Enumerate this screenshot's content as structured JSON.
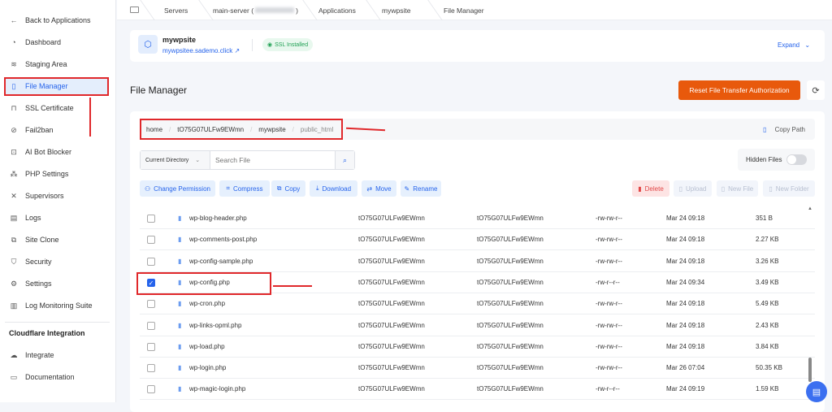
{
  "sidebar": {
    "items": [
      {
        "label": "Back to Applications",
        "icon": "arrow-left-icon"
      },
      {
        "label": "Dashboard",
        "icon": "gauge-icon"
      },
      {
        "label": "Staging Area",
        "icon": "layers-icon"
      },
      {
        "label": "File Manager",
        "icon": "file-icon",
        "active": true
      },
      {
        "label": "SSL Certificate",
        "icon": "lock-icon"
      },
      {
        "label": "Fail2ban",
        "icon": "ban-icon"
      },
      {
        "label": "AI Bot Blocker",
        "icon": "robot-icon"
      },
      {
        "label": "PHP Settings",
        "icon": "nodes-icon"
      },
      {
        "label": "Supervisors",
        "icon": "tools-icon"
      },
      {
        "label": "Logs",
        "icon": "document-icon"
      },
      {
        "label": "Site Clone",
        "icon": "copy-icon"
      },
      {
        "label": "Security",
        "icon": "shield-icon"
      },
      {
        "label": "Settings",
        "icon": "gear-icon"
      },
      {
        "label": "Log Monitoring Suite",
        "icon": "bar-chart-icon"
      }
    ],
    "section_title": "Cloudflare Integration",
    "section_items": [
      {
        "label": "Integrate",
        "icon": "cloud-icon"
      },
      {
        "label": "Documentation",
        "icon": "book-icon"
      }
    ]
  },
  "breadcrumb": [
    "Servers",
    "main-server (",
    ")",
    "Applications",
    "mywpsite",
    "File Manager"
  ],
  "app": {
    "name": "mywpsite",
    "url": "mywpsitee.sademo.click",
    "ssl": "SSL Installed",
    "expand": "Expand"
  },
  "page": {
    "title": "File Manager",
    "reset_button": "Reset File Transfer Authorization"
  },
  "path": {
    "segments": [
      "home",
      "tO75G07ULFw9EWmn",
      "mywpsite",
      "public_html"
    ],
    "copy_path": "Copy Path"
  },
  "search": {
    "scope": "Current Directory",
    "placeholder": "Search File"
  },
  "hidden_files": {
    "label": "Hidden Files",
    "enabled": false
  },
  "actions": [
    "Change Permission",
    "Compress",
    "Copy",
    "Download",
    "Move",
    "Rename"
  ],
  "actions_right": [
    "Delete",
    "Upload",
    "New File",
    "New Folder"
  ],
  "files": [
    {
      "name": "wp-blog-header.php",
      "owner": "tO75G07ULFw9EWmn",
      "group": "tO75G07ULFw9EWmn",
      "perms": "-rw-rw-r--",
      "modified": "Mar 24 09:18",
      "size": "351 B",
      "checked": false
    },
    {
      "name": "wp-comments-post.php",
      "owner": "tO75G07ULFw9EWmn",
      "group": "tO75G07ULFw9EWmn",
      "perms": "-rw-rw-r--",
      "modified": "Mar 24 09:18",
      "size": "2.27 KB",
      "checked": false
    },
    {
      "name": "wp-config-sample.php",
      "owner": "tO75G07ULFw9EWmn",
      "group": "tO75G07ULFw9EWmn",
      "perms": "-rw-rw-r--",
      "modified": "Mar 24 09:18",
      "size": "3.26 KB",
      "checked": false
    },
    {
      "name": "wp-config.php",
      "owner": "tO75G07ULFw9EWmn",
      "group": "tO75G07ULFw9EWmn",
      "perms": "-rw-r--r--",
      "modified": "Mar 24 09:34",
      "size": "3.49 KB",
      "checked": true
    },
    {
      "name": "wp-cron.php",
      "owner": "tO75G07ULFw9EWmn",
      "group": "tO75G07ULFw9EWmn",
      "perms": "-rw-rw-r--",
      "modified": "Mar 24 09:18",
      "size": "5.49 KB",
      "checked": false
    },
    {
      "name": "wp-links-opml.php",
      "owner": "tO75G07ULFw9EWmn",
      "group": "tO75G07ULFw9EWmn",
      "perms": "-rw-rw-r--",
      "modified": "Mar 24 09:18",
      "size": "2.43 KB",
      "checked": false
    },
    {
      "name": "wp-load.php",
      "owner": "tO75G07ULFw9EWmn",
      "group": "tO75G07ULFw9EWmn",
      "perms": "-rw-rw-r--",
      "modified": "Mar 24 09:18",
      "size": "3.84 KB",
      "checked": false
    },
    {
      "name": "wp-login.php",
      "owner": "tO75G07ULFw9EWmn",
      "group": "tO75G07ULFw9EWmn",
      "perms": "-rw-rw-r--",
      "modified": "Mar 26 07:04",
      "size": "50.35 KB",
      "checked": false
    },
    {
      "name": "wp-magic-login.php",
      "owner": "tO75G07ULFw9EWmn",
      "group": "tO75G07ULFw9EWmn",
      "perms": "-rw-r--r--",
      "modified": "Mar 24 09:19",
      "size": "1.59 KB",
      "checked": false
    }
  ]
}
